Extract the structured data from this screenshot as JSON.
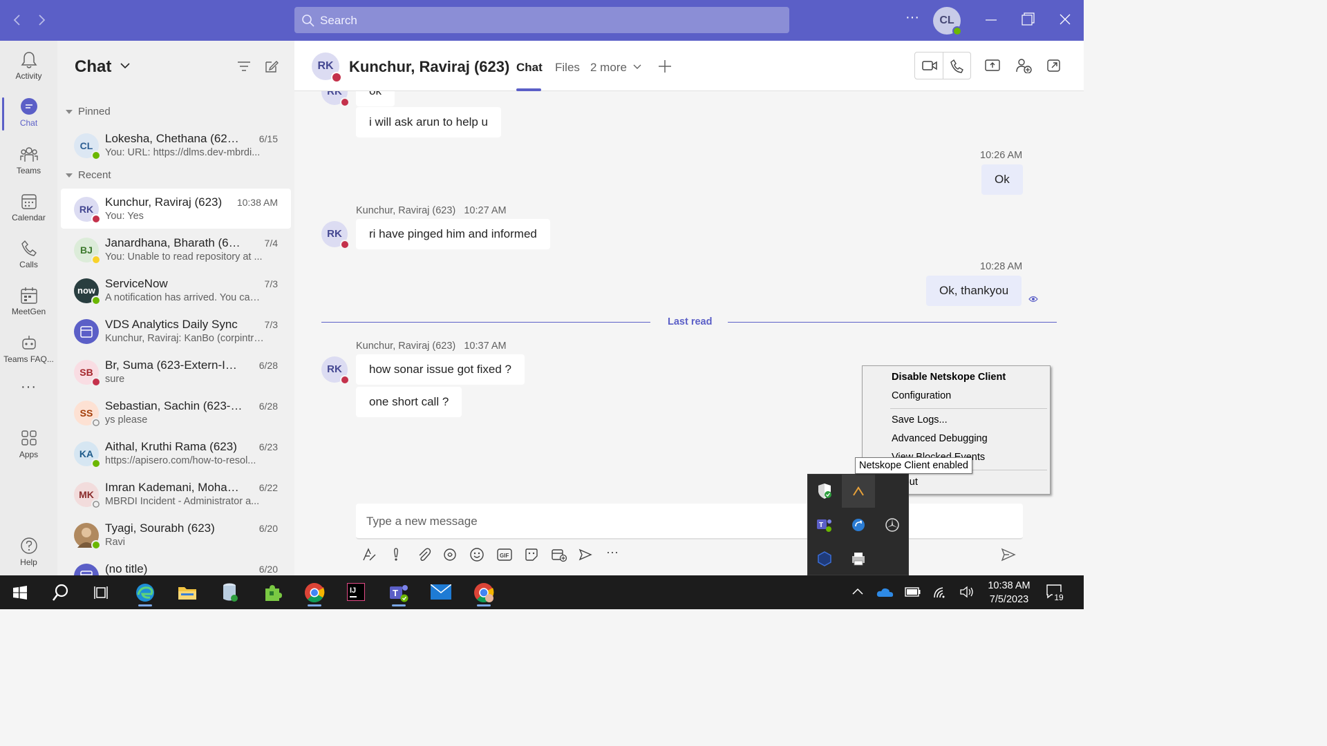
{
  "titlebar": {
    "search_placeholder": "Search",
    "more_label": "···",
    "me_initials": "CL"
  },
  "rail": [
    {
      "label": "Activity",
      "icon": "bell-icon"
    },
    {
      "label": "Chat",
      "icon": "chat-icon"
    },
    {
      "label": "Teams",
      "icon": "teams-icon"
    },
    {
      "label": "Calendar",
      "icon": "calendar-icon"
    },
    {
      "label": "Calls",
      "icon": "phone-icon"
    },
    {
      "label": "MeetGen",
      "icon": "meetgen-icon"
    },
    {
      "label": "Teams FAQ...",
      "icon": "bot-icon"
    },
    {
      "label": "···",
      "icon": "ellipsis-icon"
    },
    {
      "label": "Apps",
      "icon": "apps-icon"
    },
    {
      "label": "Help",
      "icon": "help-icon"
    }
  ],
  "chatlist": {
    "title": "Chat",
    "pinned_label": "Pinned",
    "recent_label": "Recent",
    "pinned": [
      {
        "initials": "CL",
        "name": "Lokesha, Chethana (623) (...",
        "preview": "You: URL: https://dlms.dev-mbrdi...",
        "time": "6/15",
        "status": "available",
        "avatar_bg": "#dce7f3",
        "avatar_fg": "#2e5f93"
      }
    ],
    "recent": [
      {
        "initials": "RK",
        "name": "Kunchur, Raviraj (623)",
        "preview": "You: Yes",
        "time": "10:38 AM",
        "status": "busy",
        "avatar_bg": "#dcdcf2",
        "avatar_fg": "#444791"
      },
      {
        "initials": "BJ",
        "name": "Janardhana, Bharath (623)",
        "preview": "You: Unable to read repository at ...",
        "time": "7/4",
        "status": "away",
        "avatar_bg": "#dcecd9",
        "avatar_fg": "#3e7a2f"
      },
      {
        "initials": "now",
        "name": "ServiceNow",
        "preview": "A notification has arrived. You can ...",
        "time": "7/3",
        "status": "available",
        "avatar_bg": "#293e40",
        "avatar_fg": "#ffffff"
      },
      {
        "initials": "",
        "name": "VDS Analytics Daily Sync",
        "preview": "Kunchur, Raviraj: KanBo (corpintra....",
        "time": "7/3",
        "status": "none",
        "avatar_bg": "#5b5fc7",
        "avatar_fg": "#ffffff"
      },
      {
        "initials": "SB",
        "name": "Br, Suma (623-Extern-Info...",
        "preview": "sure",
        "time": "6/28",
        "status": "busy",
        "avatar_bg": "#f9dde3",
        "avatar_fg": "#a4262c"
      },
      {
        "initials": "SS",
        "name": "Sebastian, Sachin (623-Ext...",
        "preview": "ys please",
        "time": "6/28",
        "status": "offline",
        "avatar_bg": "#fde1d3",
        "avatar_fg": "#a33e0a"
      },
      {
        "initials": "KA",
        "name": "Aithal, Kruthi Rama (623)",
        "preview": "https://apisero.com/how-to-resol...",
        "time": "6/23",
        "status": "available",
        "avatar_bg": "#d6e6f2",
        "avatar_fg": "#1f5c8b"
      },
      {
        "initials": "MK",
        "name": "Imran Kademani, Moham...",
        "preview": "MBRDI Incident - Administrator a...",
        "time": "6/22",
        "status": "offline-x",
        "avatar_bg": "#f2dcdc",
        "avatar_fg": "#8a2b2b"
      },
      {
        "initials": "",
        "name": "Tyagi, Sourabh (623)",
        "preview": "Ravi",
        "time": "6/20",
        "status": "available",
        "avatar_bg": "#b0895f",
        "avatar_fg": "#ffffff"
      },
      {
        "initials": "",
        "name": "(no title)",
        "preview": "",
        "time": "6/20",
        "status": "none",
        "avatar_bg": "#5b5fc7",
        "avatar_fg": "#ffffff"
      }
    ]
  },
  "conversation": {
    "initials": "RK",
    "name": "Kunchur, Raviraj (623)",
    "tabs": [
      "Chat",
      "Files",
      "2 more"
    ],
    "messages": {
      "m0": "ok",
      "m1": "i will ask arun to help u",
      "t2": "10:26 AM",
      "m2": "Ok",
      "meta3": "Kunchur, Raviraj (623)   10:27 AM",
      "m3": "ri have pinged him and informed",
      "t4": "10:28 AM",
      "m4": "Ok, thankyou",
      "last_read": "Last read",
      "meta5": "Kunchur, Raviraj (623)   10:37 AM",
      "m5": "how sonar issue got fixed ?",
      "m6": "one short call ?"
    },
    "compose_placeholder": "Type a new message"
  },
  "context_menu": {
    "items": [
      "Disable Netskope Client",
      "Configuration",
      "Save Logs...",
      "Advanced Debugging",
      "View Blocked Events",
      "About"
    ]
  },
  "tooltip": "Netskope Client enabled",
  "taskbar": {
    "time": "10:38 AM",
    "date": "7/5/2023",
    "notifications": "19"
  },
  "colors": {
    "brand": "#5b5fc7",
    "busy": "#c4314b",
    "available": "#6bb700",
    "away": "#f8d22a"
  }
}
